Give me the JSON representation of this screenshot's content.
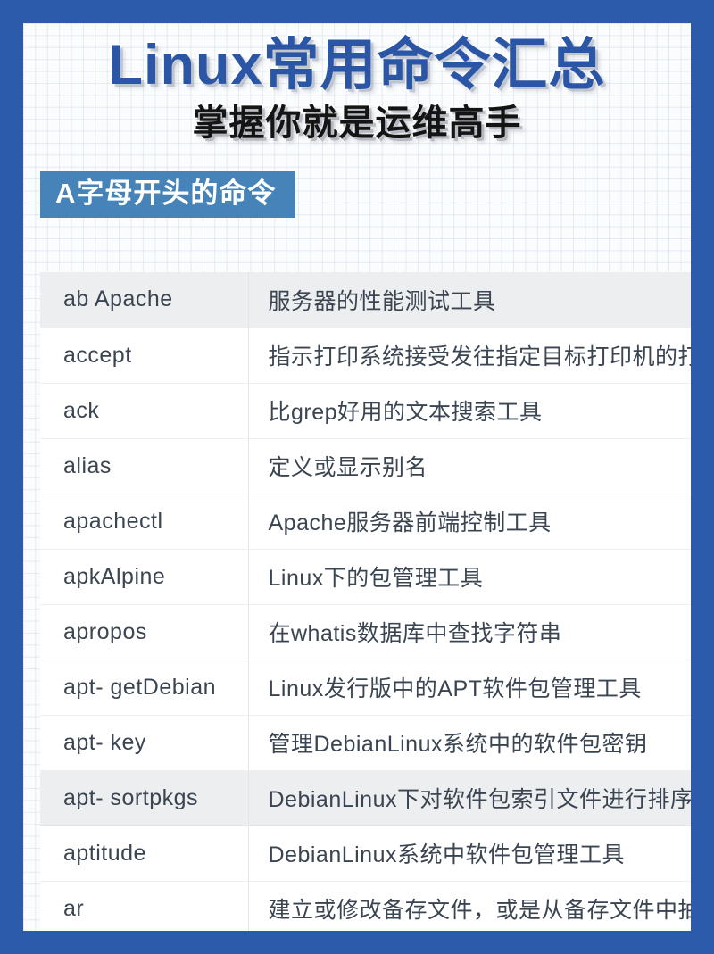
{
  "poster": {
    "title": "Linux常用命令汇总",
    "subtitle": "掌握你就是运维高手",
    "border_color": "#2d5bab",
    "title_color": "#2b55a5",
    "section_color": "#4583b8"
  },
  "section": {
    "label": "A字母开头的命令"
  },
  "table": {
    "rows": [
      {
        "command": "ab  Apache",
        "description": "服务器的性能测试工具"
      },
      {
        "command": "accept",
        "description": "指示打印系统接受发往指定目标打印机的打印任务"
      },
      {
        "command": "ack",
        "description": "比grep好用的文本搜索工具"
      },
      {
        "command": "alias",
        "description": "定义或显示别名"
      },
      {
        "command": "apachectl",
        "description": "Apache服务器前端控制工具"
      },
      {
        "command": "apkAlpine",
        "description": "Linux下的包管理工具"
      },
      {
        "command": "apropos",
        "description": "在whatis数据库中查找字符串"
      },
      {
        "command": "apt-  getDebian",
        "description": "Linux发行版中的APT软件包管理工具"
      },
      {
        "command": "apt- key",
        "description": "管理DebianLinux系统中的软件包密钥"
      },
      {
        "command": "apt-  sortpkgs",
        "description": "DebianLinux下对软件包索引文件进行排序"
      },
      {
        "command": "aptitude",
        "description": "DebianLinux系统中软件包管理工具"
      },
      {
        "command": "ar",
        "description": "建立或修改备存文件，或是从备存文件中抽取文件"
      }
    ]
  }
}
